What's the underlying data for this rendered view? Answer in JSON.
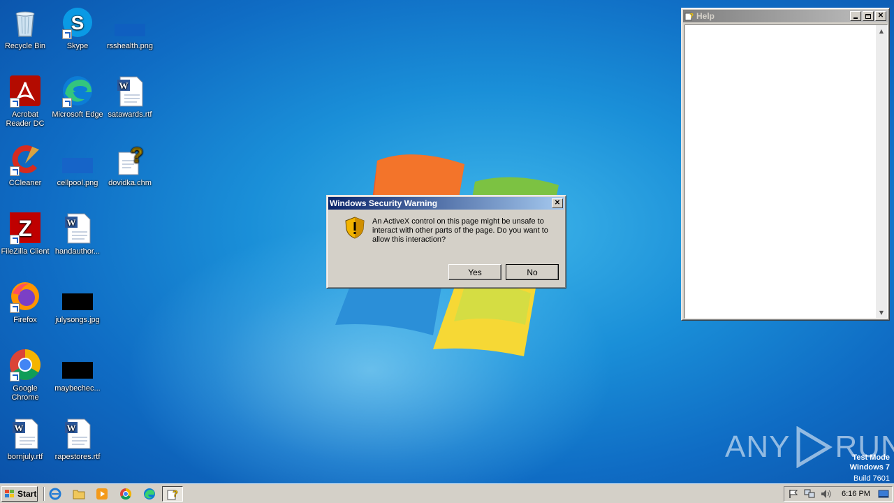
{
  "desktop": {
    "icons": [
      {
        "label": "Recycle Bin"
      },
      {
        "label": "Skype"
      },
      {
        "label": "rsshealth.png"
      },
      {
        "label": "Acrobat Reader DC"
      },
      {
        "label": "Microsoft Edge"
      },
      {
        "label": "satawards.rtf"
      },
      {
        "label": "CCleaner"
      },
      {
        "label": "cellpool.png"
      },
      {
        "label": "dovidka.chm"
      },
      {
        "label": "FileZilla Client"
      },
      {
        "label": "handauthor..."
      },
      {
        "label": "Firefox"
      },
      {
        "label": "julysongs.jpg"
      },
      {
        "label": "Google Chrome"
      },
      {
        "label": "maybechec..."
      },
      {
        "label": "bornjuly.rtf"
      },
      {
        "label": "rapestores.rtf"
      }
    ]
  },
  "help_window": {
    "title": "Help"
  },
  "dialog": {
    "title": "Windows Security Warning",
    "message": "An ActiveX control on this page might be unsafe to interact with other parts of the page. Do you want to allow this interaction?",
    "yes_label": "Yes",
    "no_label": "No",
    "icon": "warning-shield-icon"
  },
  "taskbar": {
    "start_label": "Start",
    "clock": "6:16 PM",
    "quick_launch": [
      "internet-explorer-icon",
      "explorer-folder-icon",
      "media-player-icon",
      "chrome-icon",
      "edge-icon",
      "help-task-icon"
    ]
  },
  "watermark": {
    "line1": "Test Mode",
    "line2": "Windows 7",
    "line3": "Build 7601"
  },
  "anyrun": {
    "left": "ANY",
    "right": "RUN"
  },
  "colors": {
    "title_active": "#0a246a",
    "desktop_blue": "#1a8fd8",
    "classic_gray": "#d4d0c8"
  }
}
